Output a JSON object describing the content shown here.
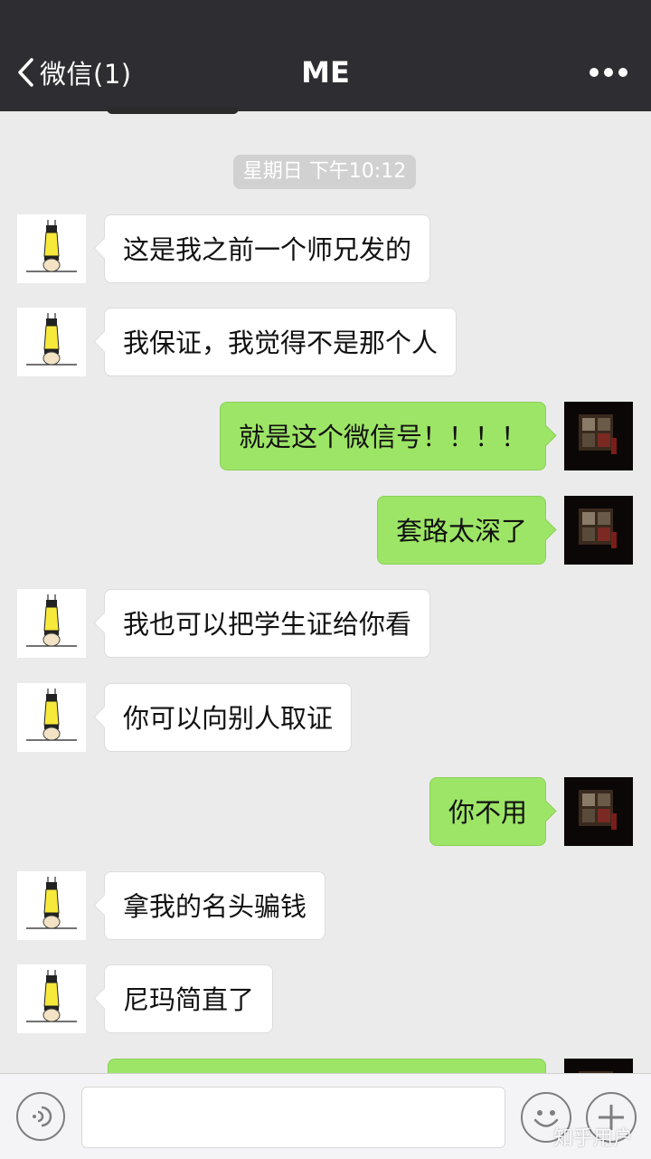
{
  "header": {
    "back_label": "微信(1)",
    "title": "ME",
    "more_icon": "more-dots-icon"
  },
  "chat": {
    "timestamp": "星期日 下午10:12",
    "messages": [
      {
        "side": "left",
        "text": "这是我之前一个师兄发的"
      },
      {
        "side": "left",
        "text": "我保证，我觉得不是那个人"
      },
      {
        "side": "right",
        "text": "就是这个微信号！！！！"
      },
      {
        "side": "right",
        "text": "套路太深了"
      },
      {
        "side": "left",
        "text": "我也可以把学生证给你看"
      },
      {
        "side": "left",
        "text": "你可以向别人取证"
      },
      {
        "side": "right",
        "text": "你不用"
      },
      {
        "side": "left",
        "text": "拿我的名头骗钱"
      },
      {
        "side": "left",
        "text": "尼玛简直了"
      },
      {
        "side": "right",
        "text": ""
      }
    ]
  },
  "input_bar": {
    "voice_icon": "voice-icon",
    "emoji_icon": "emoji-icon",
    "plus_icon": "plus-icon",
    "input_value": ""
  },
  "watermark": "知乎用户",
  "colors": {
    "header_bg": "#2e2e32",
    "chat_bg": "#ebebeb",
    "sent_bubble": "#9de566",
    "received_bubble": "#ffffff",
    "timestamp_pill": "#d1d1d1"
  }
}
